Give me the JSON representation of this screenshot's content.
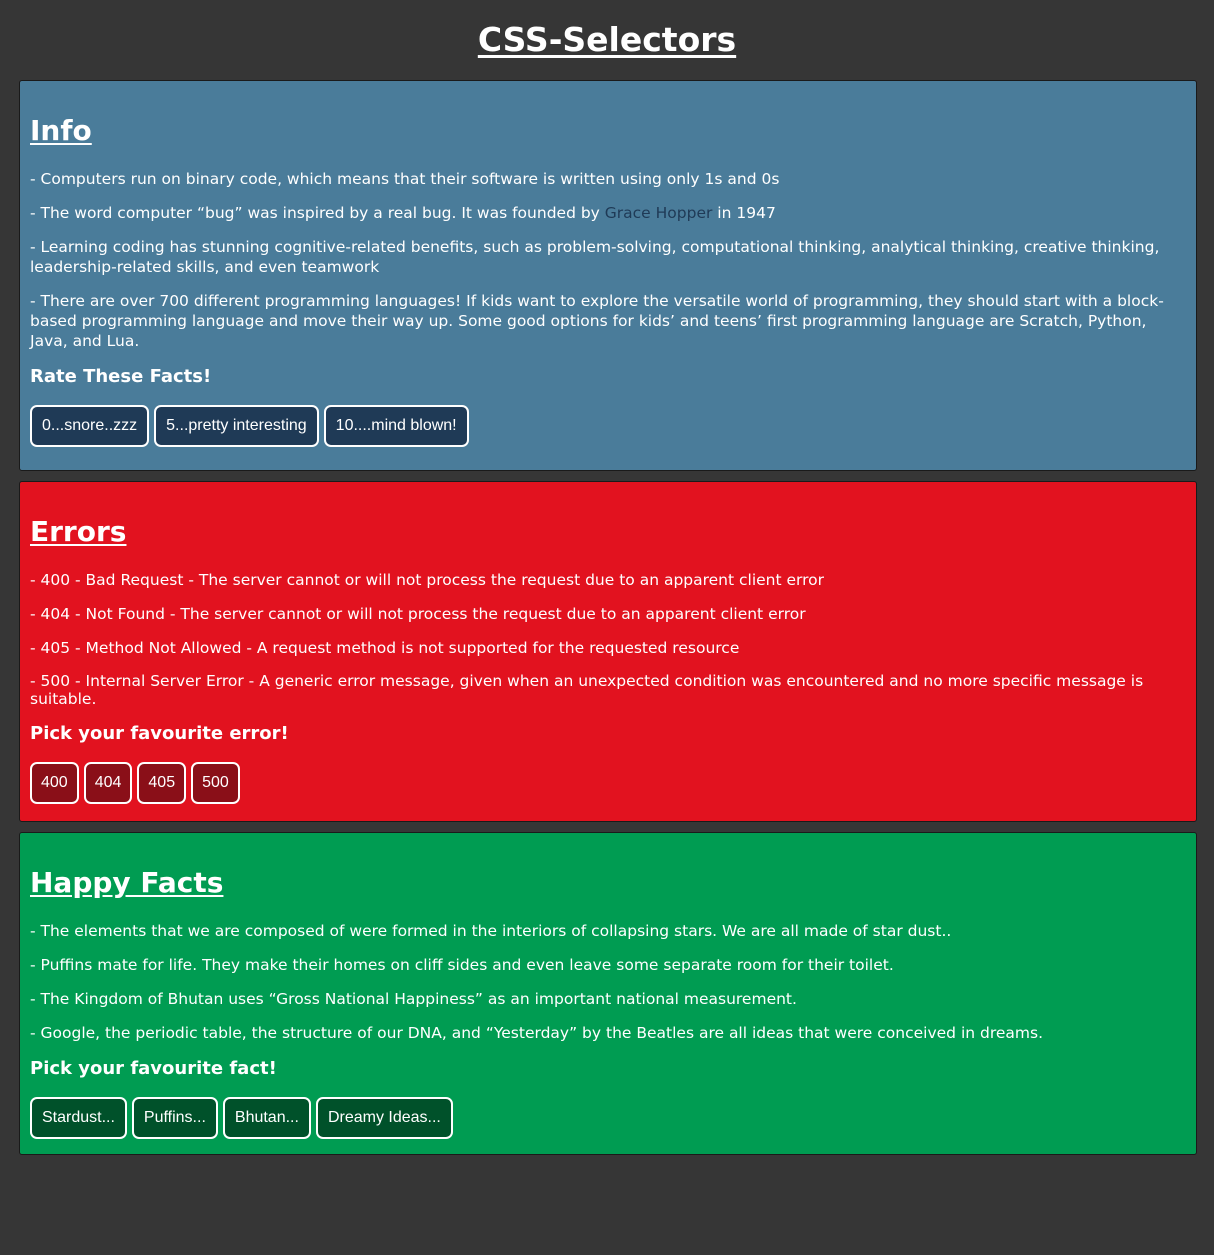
{
  "page": {
    "title": "CSS-Selectors"
  },
  "info": {
    "heading": "Info",
    "facts": {
      "f0": "- Computers run on binary code, which means that their software is written using only 1s and 0s",
      "f1_before": "- The word computer “bug” was inspired by a real bug. It was founded by ",
      "f1_link": "Grace Hopper",
      "f1_after": " in 1947",
      "f2": "- Learning coding has stunning cognitive-related benefits, such as problem-solving, computational thinking, analytical thinking, creative thinking, leadership-related skills, and even teamwork",
      "f3": "- There are over 700 different programming languages! If kids want to explore the versatile world of programming, they should start with a block-based programming language and move their way up. Some good options for kids’ and teens’ first programming language are Scratch, Python, Java, and Lua."
    },
    "prompt": "Rate These Facts!",
    "buttons": [
      "0...snore..zzz",
      "5...pretty interesting",
      "10....mind blown!"
    ]
  },
  "errors": {
    "heading": "Errors",
    "facts": [
      "- 400 - Bad Request - The server cannot or will not process the request due to an apparent client error",
      "- 404 - Not Found - The server cannot or will not process the request due to an apparent client error",
      "- 405 - Method Not Allowed - A request method is not supported for the requested resource",
      "- 500 - Internal Server Error - A generic error message, given when an unexpected condition was encountered and no more specific message is suitable."
    ],
    "prompt": "Pick your favourite error!",
    "buttons": [
      "400",
      "404",
      "405",
      "500"
    ]
  },
  "happy": {
    "heading": "Happy Facts",
    "facts": [
      "- The elements that we are composed of were formed in the interiors of collapsing stars. We are all made of star dust..",
      "- Puffins mate for life. They make their homes on cliff sides and even leave some separate room for their toilet.",
      "- The Kingdom of Bhutan uses “Gross National Happiness” as an important national measurement.",
      "- Google, the periodic table, the structure of our DNA, and “Yesterday” by the Beatles are all ideas that were conceived in dreams."
    ],
    "prompt": "Pick your favourite fact!",
    "buttons": [
      "Stardust...",
      "Puffins...",
      "Bhutan...",
      "Dreamy Ideas..."
    ]
  },
  "colors": {
    "background": "#363636",
    "info_panel": "#4a7c9a",
    "info_button": "#1f3a56",
    "errors_panel": "#e2121f",
    "errors_button": "#8a0f18",
    "happy_panel": "#009c52",
    "happy_button": "#00512a"
  }
}
